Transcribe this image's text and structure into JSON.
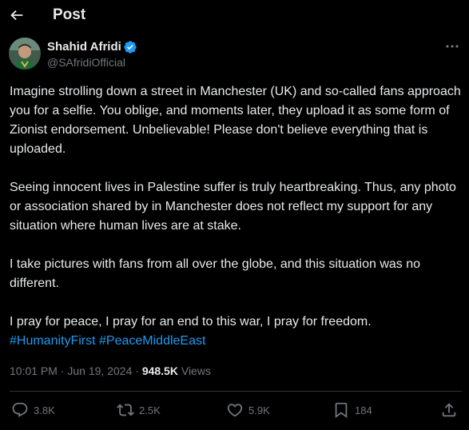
{
  "header": {
    "title": "Post",
    "back_icon": "arrow-left-icon"
  },
  "author": {
    "name": "Shahid Afridi",
    "handle": "@SAfridiOfficial",
    "verified_icon": "verified-badge-icon",
    "more_icon": "more-horizontal-icon"
  },
  "post": {
    "paragraphs": [
      "Imagine strolling down a street in Manchester (UK) and so-called fans approach you for a selfie. You oblige, and moments later, they upload it as some form of Zionist endorsement. Unbelievable! Please don't believe everything that is uploaded.",
      "Seeing innocent lives in Palestine suffer is truly heartbreaking. Thus, any photo or association shared by in Manchester does not reflect my support for any situation where human lives are at stake.",
      "I take pictures with fans from all over the globe, and this situation was no different.",
      "I pray for peace, I pray for an end to this war, I pray for freedom."
    ],
    "hashtags": [
      "#HumanityFirst",
      "#PeaceMiddleEast"
    ]
  },
  "meta": {
    "time": "10:01 PM",
    "separator": "·",
    "date": "Jun 19, 2024",
    "views_count": "948.5K",
    "views_label": "Views"
  },
  "actions": {
    "replies": "3.8K",
    "reposts": "2.5K",
    "likes": "5.9K",
    "bookmarks": "184"
  },
  "colors": {
    "background": "#000000",
    "text": "#e7e9ea",
    "secondary": "#71767b",
    "accent": "#1d9bf0",
    "divider": "#2f3336"
  }
}
